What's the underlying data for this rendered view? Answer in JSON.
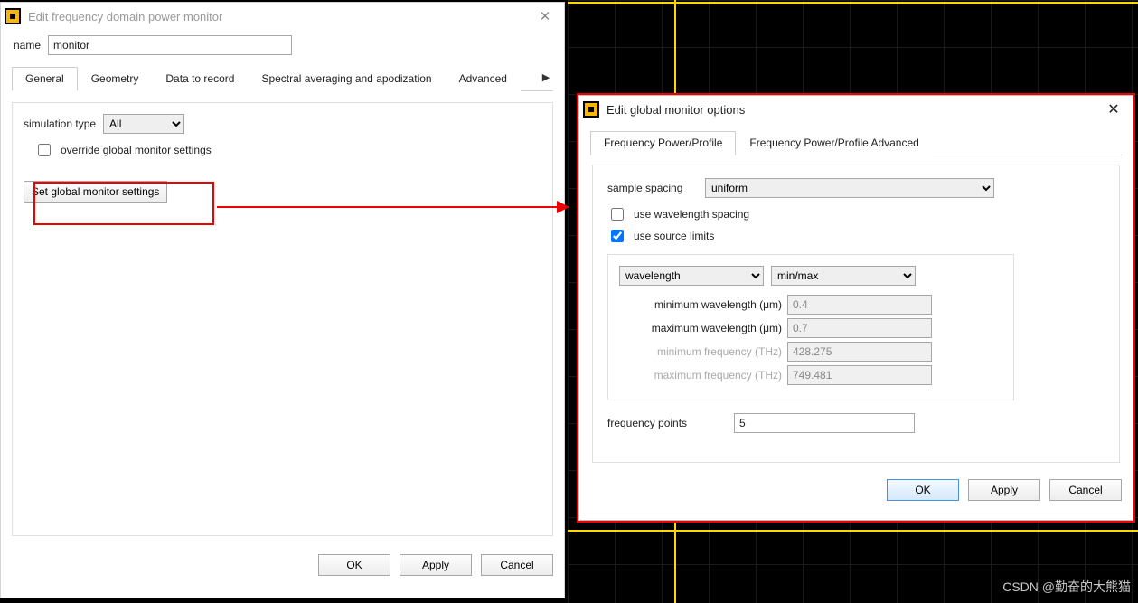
{
  "left": {
    "title": "Edit frequency domain power monitor",
    "name_label": "name",
    "name_value": "monitor",
    "tabs": [
      "General",
      "Geometry",
      "Data to record",
      "Spectral averaging and apodization",
      "Advanced"
    ],
    "sim_type_label": "simulation type",
    "sim_type_value": "All",
    "override_label": "override global monitor settings",
    "set_global_btn": "Set global monitor settings",
    "ok": "OK",
    "apply": "Apply",
    "cancel": "Cancel"
  },
  "right": {
    "title": "Edit global monitor options",
    "tabs": [
      "Frequency Power/Profile",
      "Frequency Power/Profile Advanced"
    ],
    "sample_spacing_label": "sample spacing",
    "sample_spacing_value": "uniform",
    "use_wavelength_spacing": "use wavelength spacing",
    "use_source_limits": "use source limits",
    "dd1": "wavelength",
    "dd2": "min/max",
    "min_wl_label": "minimum wavelength (μm)",
    "min_wl_val": "0.4",
    "max_wl_label": "maximum wavelength (μm)",
    "max_wl_val": "0.7",
    "min_f_label": "minimum frequency (THz)",
    "min_f_val": "428.275",
    "max_f_label": "maximum frequency (THz)",
    "max_f_val": "749.481",
    "freq_pts_label": "frequency points",
    "freq_pts_val": "5",
    "ok": "OK",
    "apply": "Apply",
    "cancel": "Cancel"
  },
  "watermark": "CSDN @勤奋的大熊猫"
}
